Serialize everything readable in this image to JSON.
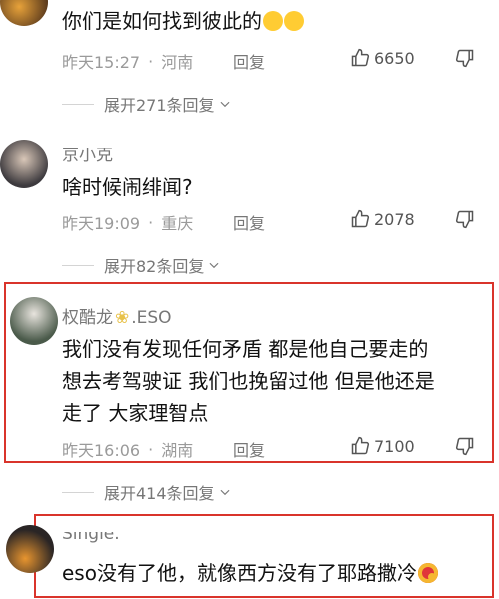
{
  "comments": [
    {
      "text": "你们是如何找到彼此的",
      "time": "昨天15:27",
      "location": "河南",
      "reply_label": "回复",
      "likes": "6650",
      "expand_label": "展开271条回复"
    },
    {
      "username": "京小克",
      "text": "啥时候闹绯闻?",
      "time": "昨天19:09",
      "location": "重庆",
      "reply_label": "回复",
      "likes": "2078",
      "expand_label": "展开82条回复"
    },
    {
      "username": "权酷龙",
      "username_suffix": ".ESO",
      "text_lines": [
        "我们没有发现任何矛盾 都是他自己要走的",
        "想去考驾驶证 我们也挽留过他 但是他还是",
        "走了 大家理智点"
      ],
      "time": "昨天16:06",
      "location": "湖南",
      "reply_label": "回复",
      "likes": "7100",
      "expand_label": "展开414条回复"
    },
    {
      "username": "Single.",
      "text": "eso没有了他，就像西方没有了耶路撒冷"
    }
  ],
  "colors": {
    "highlight_border": "#d9342b",
    "meta_text": "#9a9a9a",
    "body_text": "#111111"
  },
  "icons": [
    "thumbs-up-icon",
    "thumbs-down-icon",
    "chevron-down-icon",
    "crying-emoji",
    "heart-eyes-emoji",
    "flower-emoji"
  ]
}
